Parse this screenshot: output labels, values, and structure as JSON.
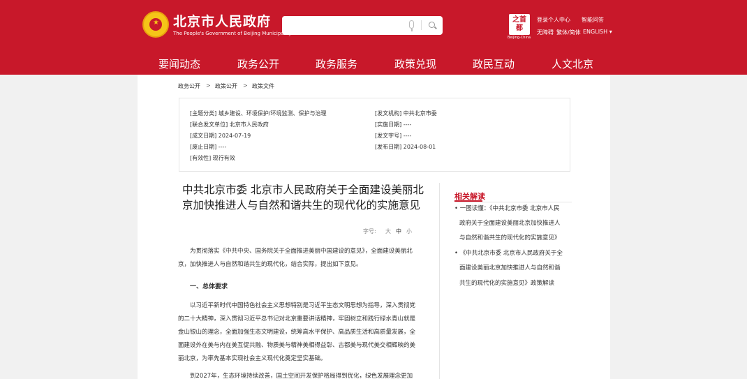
{
  "header": {
    "site_title": "北京市人民政府",
    "site_subtitle": "The People's Government of Beijing Municipality",
    "search_placeholder": "",
    "seal_text": "之首都",
    "seal_caption": "Beijing-China",
    "login_label": "登录个人中心",
    "smart_qa_label": "智能问答",
    "accessibility_label": "无障碍",
    "traditional_label": "繁体/简体",
    "language_label": "ENGLISH ▾",
    "brand_color": "#c8182a"
  },
  "nav": {
    "items": [
      "要闻动态",
      "政务公开",
      "政务服务",
      "政策兑现",
      "政民互动",
      "人文北京"
    ]
  },
  "breadcrumb": {
    "items": [
      "政务公开",
      "政策公开",
      "政策文件"
    ],
    "separator": ">"
  },
  "doc_info": {
    "category": "[主题分类] 城乡建设、环境保护/环境监测、保护与治理",
    "joint_issuer": "[联合发文单位] 北京市人民政府",
    "written_date": "[成文日期] 2024-07-19",
    "abolished_date": "[废止日期] ----",
    "validity": "[有效性] 现行有效",
    "issuer": "[发文机构] 中共北京市委",
    "effective_date": "[实施日期] ----",
    "doc_number": "[发文字号] ----",
    "publish_date": "[发布日期] 2024-08-01"
  },
  "article": {
    "title_line1": "中共北京市委 北京市人民政府关于全面建设美丽北",
    "title_line2": "京加快推进人与自然和谐共生的现代化的实施意见",
    "font_size_label": "字号:",
    "font_size_options": [
      "大",
      "中",
      "小"
    ],
    "para1_line1": "为贯彻落实《中共中央、国务院关于全面推进美丽中国建设的意见》，全面建设美丽北",
    "para1_line2": "京，加快推进人与自然和谐共生的现代化，结合实际，提出如下意见。",
    "section1_title": "一、总体要求",
    "para2_line1": "以习近平新时代中国特色社会主义思想特别是习近平生态文明思想为指导，深入贯彻党",
    "para2_line2": "的二十大精神，深入贯彻习近平总书记对北京重要讲话精神，牢固树立和践行绿水青山就是",
    "para2_line3": "金山银山的理念，全面加强生态文明建设，统筹高水平保护、高品质生活和高质量发展，全",
    "para2_line4": "面建设外在美与内在美互促共融、物质美与精神美相得益彰、古都美与现代美交相辉映的美",
    "para2_line5": "丽北京，为率先基本实现社会主义现代化奠定坚实基础。",
    "para3_line1": "到2027年，生态环境持续改善，国土空间开发保护格局得到优化，绿色发展理念更加"
  },
  "related": {
    "title": "相关解读",
    "item1_line1": "• 一图读懂：《中共北京市委 北京市人民",
    "item1_line2": "政府关于全面建设美丽北京加快推进人",
    "item1_line3": "与自然和谐共生的现代化的实施意见》",
    "item2_line1": "• 《中共北京市委 北京市人民政府关于全",
    "item2_line2": "面建设美丽北京加快推进人与自然和谐",
    "item2_line3": "共生的现代化的实施意见》政策解读"
  }
}
